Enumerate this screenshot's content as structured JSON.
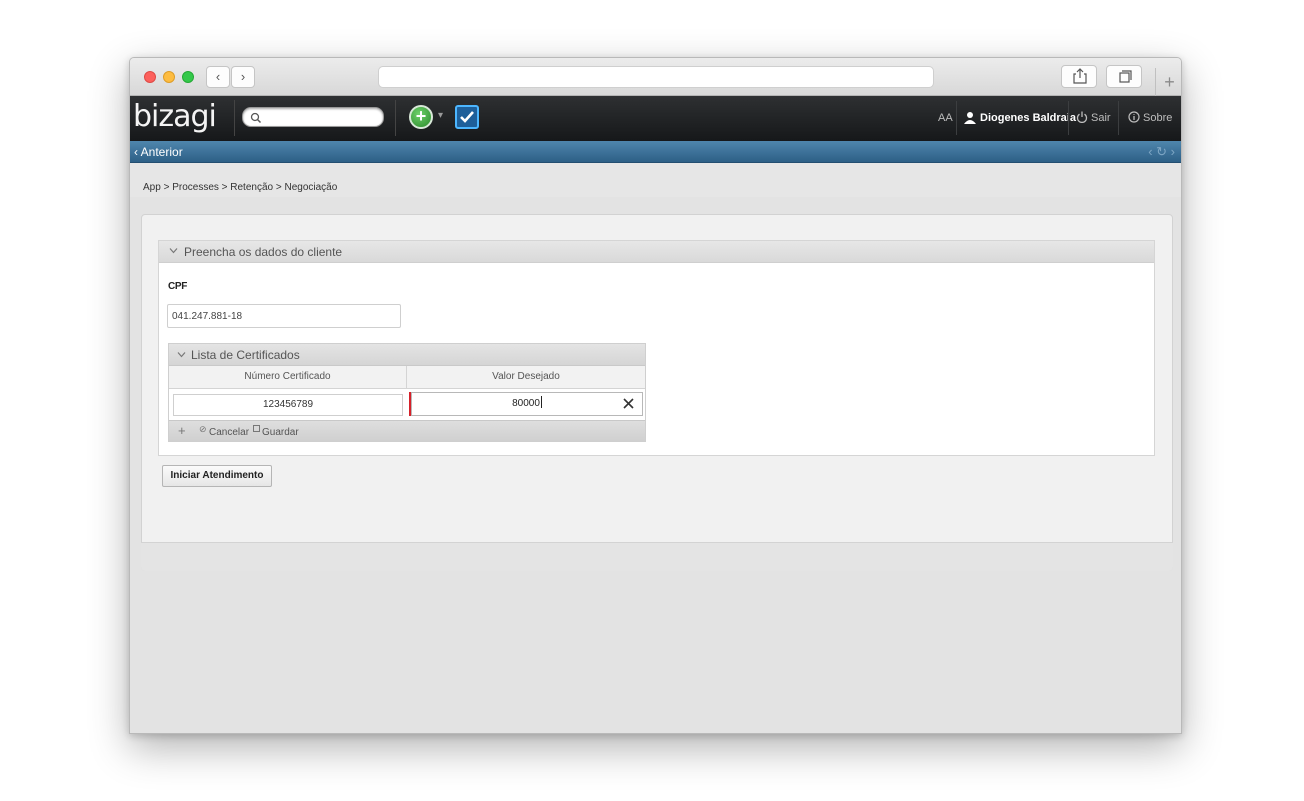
{
  "browser": {
    "back_glyph": "‹",
    "forward_glyph": "›",
    "new_tab_glyph": "+",
    "address": ""
  },
  "header": {
    "logo": "bizagi",
    "search_placeholder": "",
    "plus_glyph": "+",
    "dropdown_glyph": "▾",
    "font_size_toggle": "AA",
    "user_name": "Diogenes Baldraia",
    "logout_label": "Sair",
    "about_label": "Sobre"
  },
  "nav": {
    "back_label": "Anterior",
    "history_controls": "‹ ↻ ›"
  },
  "breadcrumb": "App > Processes > Retenção > Negociação",
  "form": {
    "group_title": "Preencha os dados do cliente",
    "cpf_label": "CPF",
    "cpf_value": "041.247.881-18",
    "grid": {
      "title": "Lista de Certificados",
      "columns": [
        "Número Certificado",
        "Valor Desejado"
      ],
      "rows": [
        {
          "numero": "123456789",
          "valor": "80000"
        }
      ],
      "add_glyph": "+",
      "cancel_label": "Cancelar",
      "save_label": "Guardar"
    },
    "submit_label": "Iniciar Atendimento"
  },
  "colors": {
    "header_dark": "#1f2123",
    "nav_blue": "#3d7299",
    "required_red": "#d6212a",
    "checkbox_blue": "#4cb6ff",
    "plus_green": "#3aa83a"
  },
  "icons": {
    "search": "search-icon",
    "new_case": "plus-circle-icon",
    "inbox": "checkbox-icon",
    "user": "user-icon",
    "logout": "power-icon",
    "about": "info-icon",
    "collapse": "chevron-down-icon",
    "clear": "close-icon",
    "cancel": "cancel-icon",
    "save": "save-icon"
  }
}
